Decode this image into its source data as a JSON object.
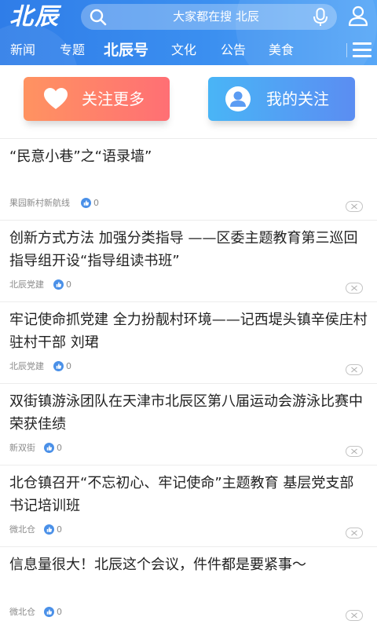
{
  "header": {
    "logo": "北辰",
    "search_placeholder": "大家都在搜 北辰",
    "brand_color": "#3787ec"
  },
  "nav": {
    "tabs": [
      {
        "label": "新闻",
        "active": false
      },
      {
        "label": "专题",
        "active": false
      },
      {
        "label": "北辰号",
        "active": true
      },
      {
        "label": "文化",
        "active": false
      },
      {
        "label": "公告",
        "active": false
      },
      {
        "label": "美食",
        "active": false
      }
    ],
    "menu_icon": "hamburger-menu-icon"
  },
  "actions": {
    "follow_more": {
      "label": "关注更多",
      "icon": "heart-icon",
      "color": "#ff7f6b"
    },
    "my_follow": {
      "label": "我的关注",
      "icon": "user-circle-icon",
      "color": "#5298f4"
    }
  },
  "articles": [
    {
      "title": "“民意小巷”之“语录墙”",
      "source": "果园新村新航线",
      "likes": "0"
    },
    {
      "title": "创新方式方法 加强分类指导 ——区委主题教育第三巡回指导组开设“指导组读书班”",
      "source": "北辰党建",
      "likes": "0"
    },
    {
      "title": "牢记使命抓党建 全力扮靓村环境——记西堤头镇辛侯庄村驻村干部 刘珺",
      "source": "北辰党建",
      "likes": "0"
    },
    {
      "title": "双街镇游泳团队在天津市北辰区第八届运动会游泳比赛中荣获佳绩",
      "source": "新双街",
      "likes": "0"
    },
    {
      "title": "北仓镇召开“不忘初心、牢记使命”主题教育 基层党支部书记培训班",
      "source": "微北仓",
      "likes": "0"
    },
    {
      "title": "信息量很大！北辰这个会议，件件都是要紧事～",
      "source": "微北仓",
      "likes": "0"
    }
  ]
}
